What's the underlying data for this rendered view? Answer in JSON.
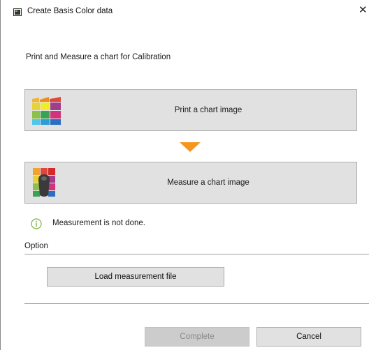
{
  "window": {
    "title": "Create Basis Color data",
    "close_glyph": "✕"
  },
  "heading": "Print and Measure a chart for Calibration",
  "print_button": {
    "label": "Print a chart image",
    "icon": "color-chart-icon"
  },
  "measure_button": {
    "label": "Measure a chart image",
    "icon": "measure-chart-icon"
  },
  "status": {
    "text": "Measurement is not done.",
    "icon": "info-icon",
    "color": "#7cb342"
  },
  "option": {
    "label": "Option",
    "load_button_label": "Load measurement file"
  },
  "footer": {
    "complete_label": "Complete",
    "complete_enabled": false,
    "cancel_label": "Cancel"
  },
  "colors": {
    "arrow": "#f6961e",
    "button_bg": "#e1e1e1"
  }
}
